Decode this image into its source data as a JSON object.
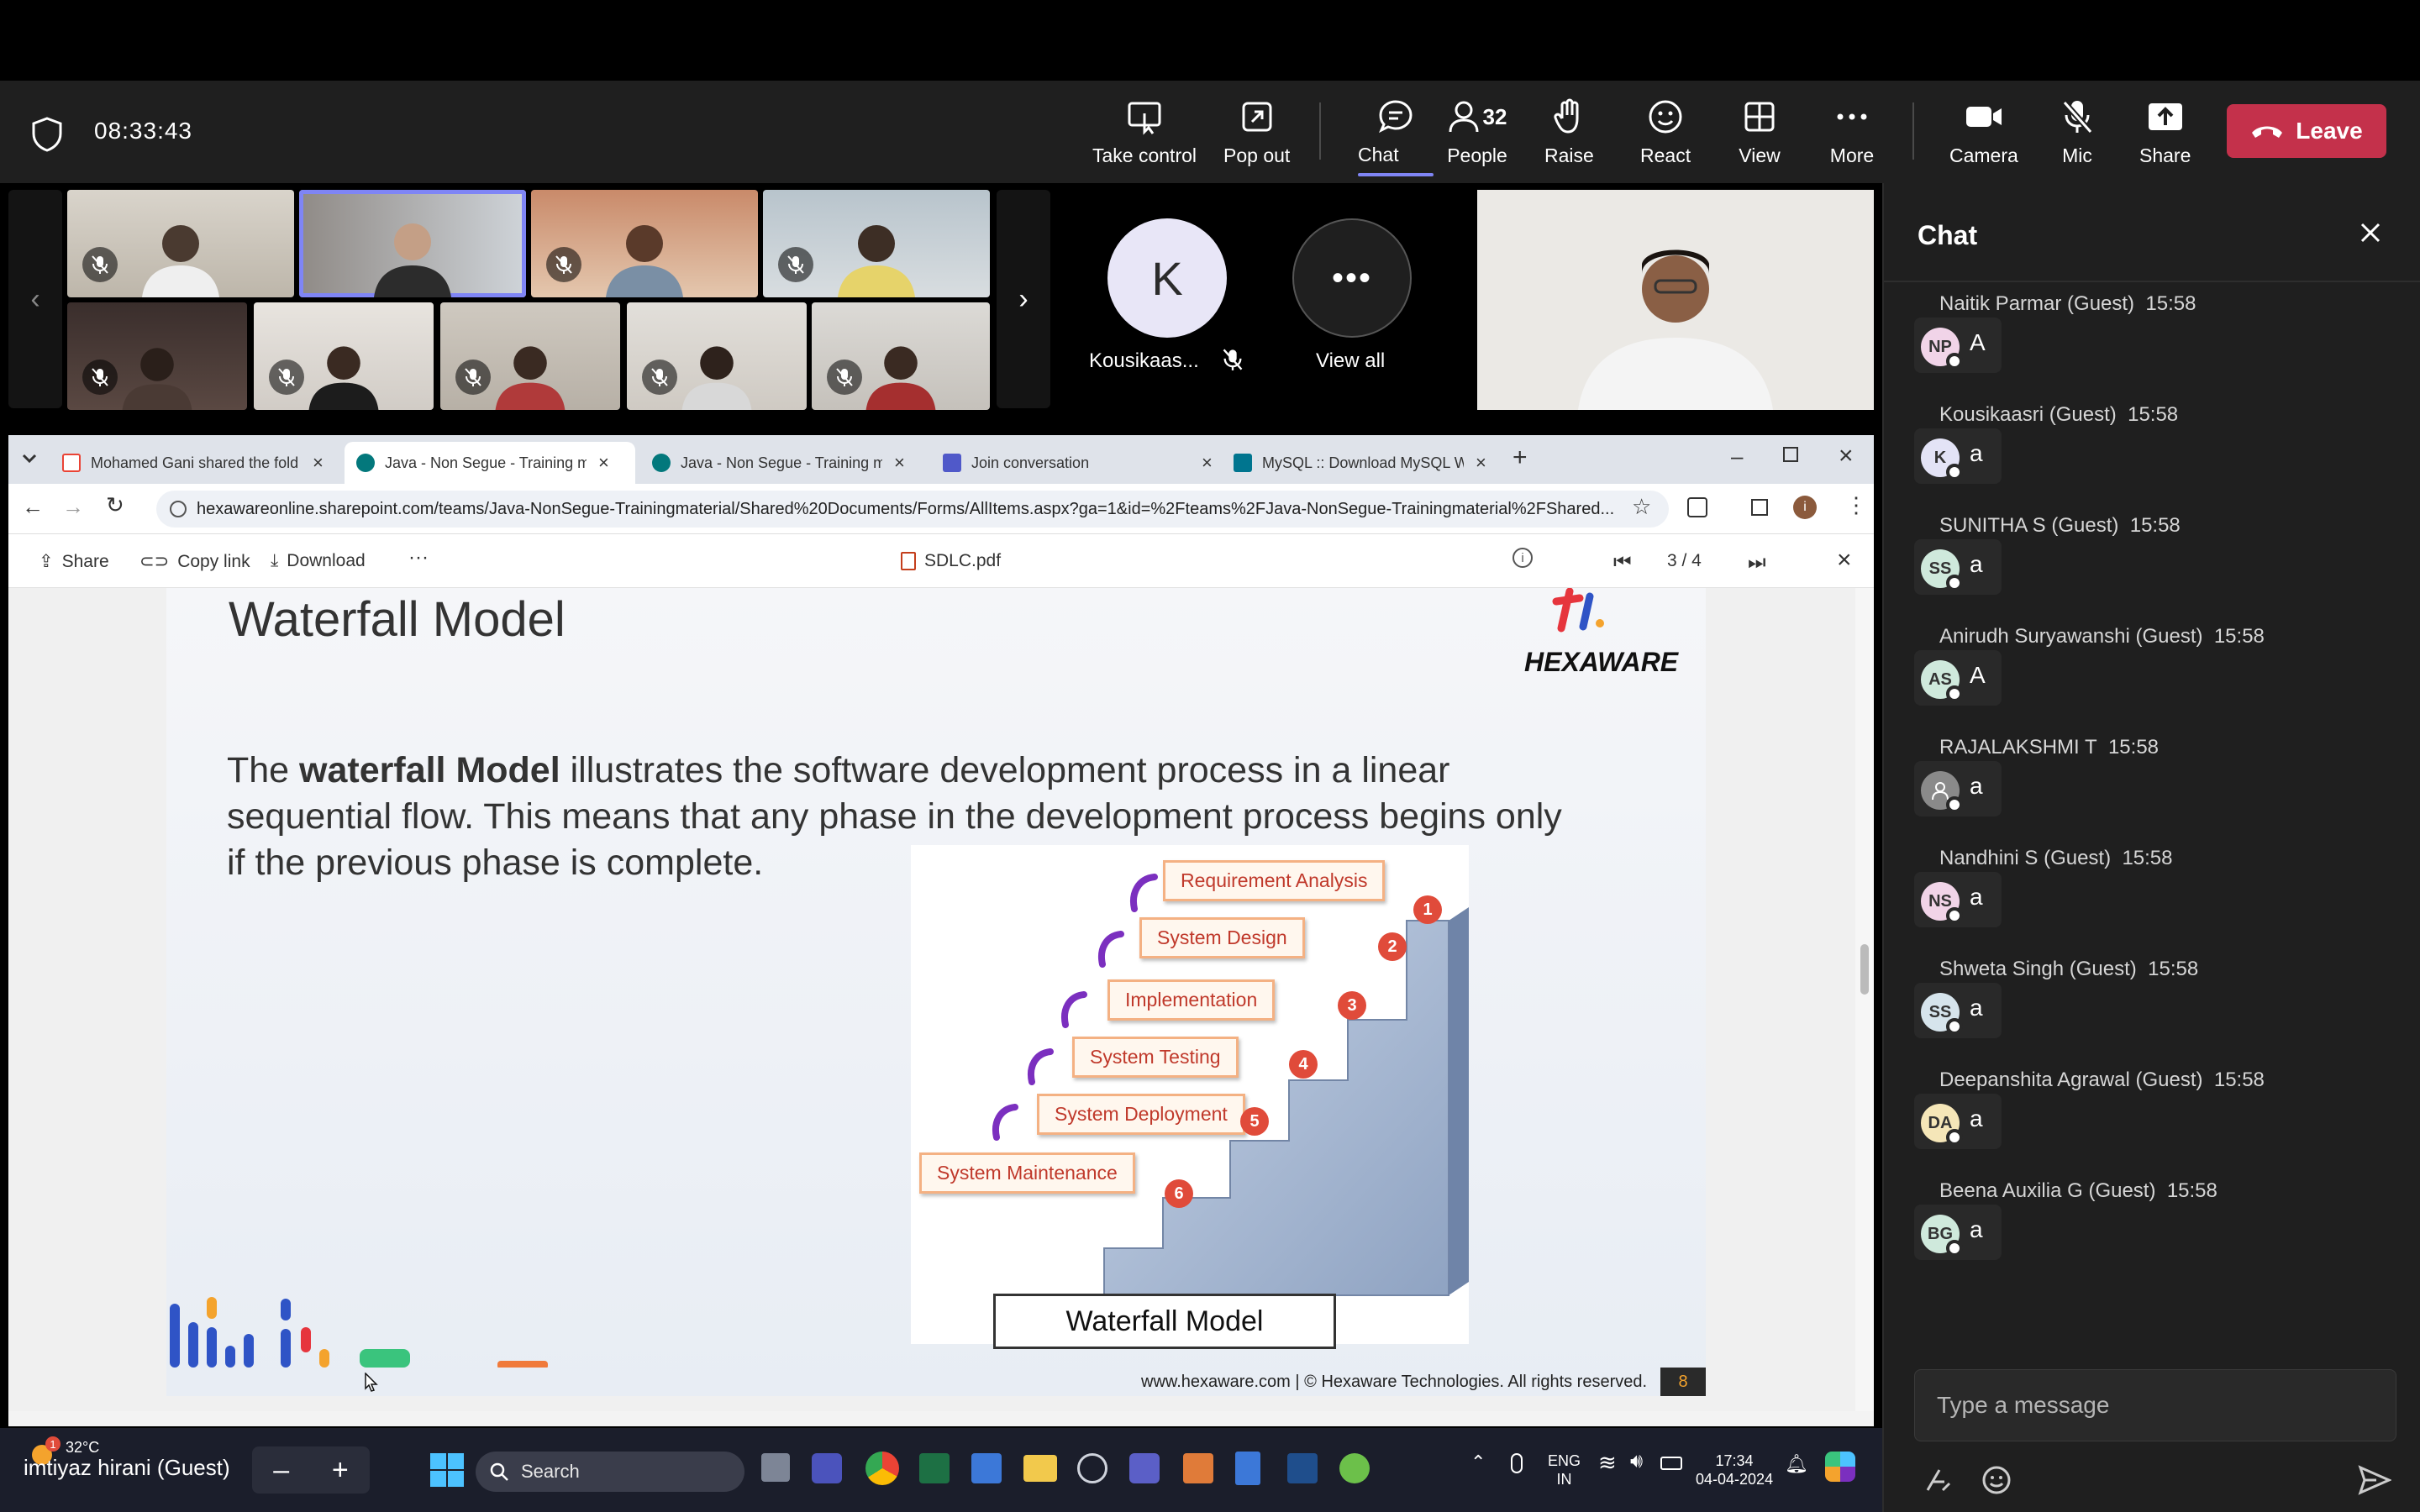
{
  "meeting": {
    "timer": "08:33:43",
    "toolbar": [
      {
        "label": "Take control",
        "icon": "take-control-icon"
      },
      {
        "label": "Pop out",
        "icon": "pop-out-icon"
      },
      {
        "label": "Chat",
        "icon": "chat-icon"
      },
      {
        "label": "People",
        "icon": "people-icon",
        "count": "32"
      },
      {
        "label": "Raise",
        "icon": "hand-icon"
      },
      {
        "label": "React",
        "icon": "smiley-icon"
      },
      {
        "label": "View",
        "icon": "grid-icon"
      },
      {
        "label": "More",
        "icon": "more-icon"
      },
      {
        "label": "Camera",
        "icon": "camera-icon"
      },
      {
        "label": "Mic",
        "icon": "mic-off-icon"
      },
      {
        "label": "Share",
        "icon": "share-icon"
      }
    ],
    "leave_label": "Leave",
    "accent": "#7f85f5",
    "leave_color": "#c4314b"
  },
  "gallery": {
    "featured_initial": "K",
    "featured_name": "Kousikaas...",
    "view_all_label": "View all"
  },
  "chat": {
    "title": "Chat",
    "messages": [
      {
        "name": "Naitik Parmar (Guest)",
        "time": "15:58",
        "initials": "NP",
        "text": "A",
        "avatar_color": "#f1d4e8"
      },
      {
        "name": "Kousikaasri (Guest)",
        "time": "15:58",
        "initials": "K",
        "text": "a",
        "avatar_color": "#e3e3f6"
      },
      {
        "name": "SUNITHA S (Guest)",
        "time": "15:58",
        "initials": "SS",
        "text": "a",
        "avatar_color": "#cfe9dc"
      },
      {
        "name": "Anirudh Suryawanshi (Guest)",
        "time": "15:58",
        "initials": "AS",
        "text": "A",
        "avatar_color": "#cfe9dc"
      },
      {
        "name": "RAJALAKSHMI T",
        "time": "15:58",
        "initials": "",
        "text": "a",
        "avatar_color": "#8a8a8a"
      },
      {
        "name": "Nandhini S (Guest)",
        "time": "15:58",
        "initials": "NS",
        "text": "a",
        "avatar_color": "#f1d4e8"
      },
      {
        "name": "Shweta Singh (Guest)",
        "time": "15:58",
        "initials": "SS",
        "text": "a",
        "avatar_color": "#d6e4ec"
      },
      {
        "name": "Deepanshita Agrawal (Guest)",
        "time": "15:58",
        "initials": "DA",
        "text": "a",
        "avatar_color": "#f5e6b8"
      },
      {
        "name": "Beena Auxilia G (Guest)",
        "time": "15:58",
        "initials": "BG",
        "text": "a",
        "avatar_color": "#cfe9dc"
      }
    ],
    "compose_placeholder": "Type a message"
  },
  "browser": {
    "tabs": [
      {
        "title": "Mohamed Gani shared the fold",
        "icon": "gmail-icon",
        "color": "#ea4335"
      },
      {
        "title": "Java - Non Segue - Training ma",
        "icon": "sharepoint-icon",
        "color": "#03787c"
      },
      {
        "title": "Java - Non Segue - Training ma",
        "icon": "sharepoint-icon",
        "color": "#03787c"
      },
      {
        "title": "Join conversation",
        "icon": "teams-icon",
        "color": "#5059c9"
      },
      {
        "title": "MySQL :: Download MySQL Wo",
        "icon": "mysql-icon",
        "color": "#00758f"
      }
    ],
    "url": "hexawareonline.sharepoint.com/teams/Java-NonSegue-Trainingmaterial/Shared%20Documents/Forms/AllItems.aspx?ga=1&id=%2Fteams%2FJava-NonSegue-Trainingmaterial%2FShared...",
    "profile_initial": "i"
  },
  "pdf": {
    "share_label": "Share",
    "copy_link_label": "Copy link",
    "download_label": "Download",
    "file_name": "SDLC.pdf",
    "page_indicator": "3 / 4"
  },
  "slide": {
    "title": "Waterfall Model",
    "logo_text": "HEXAWARE",
    "body_pre": "The ",
    "body_bold": "waterfall Model",
    "body_post": " illustrates the software development process in a linear sequential flow. This means that any phase in the development process begins only if the previous phase is complete.",
    "steps": [
      {
        "label": "Requirement Analysis",
        "num": "1"
      },
      {
        "label": "System Design",
        "num": "2"
      },
      {
        "label": "Implementation",
        "num": "3"
      },
      {
        "label": "System Testing",
        "num": "4"
      },
      {
        "label": "System Deployment",
        "num": "5"
      },
      {
        "label": "System Maintenance",
        "num": "6"
      }
    ],
    "diagram_caption": "Waterfall Model",
    "footer": "www.hexaware.com  | © Hexaware Technologies. All rights reserved.",
    "page_number": "8"
  },
  "taskbar": {
    "presenter": "imtiyaz hirani (Guest)",
    "weather": "32°C",
    "weather_badge": "1",
    "search_label": "Search",
    "lang_top": "ENG",
    "lang_bottom": "IN",
    "time": "17:34",
    "date": "04-04-2024"
  }
}
